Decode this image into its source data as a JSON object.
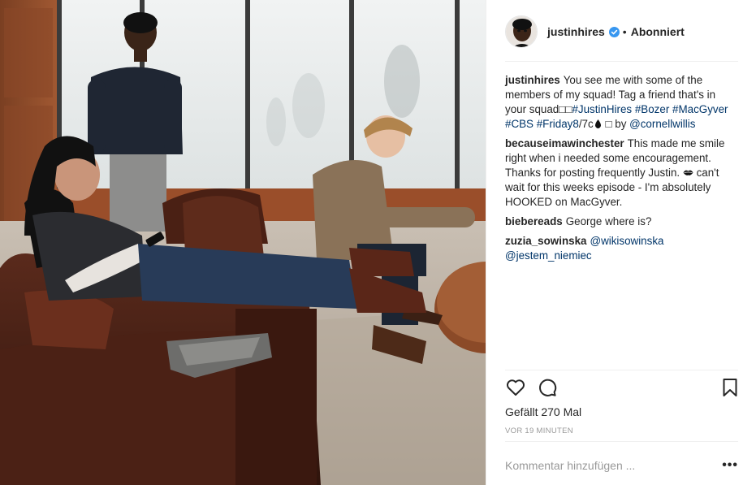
{
  "post": {
    "image_description": "",
    "header": {
      "username": "justinhires",
      "verified": true,
      "separator": "•",
      "follow_status": "Abonniert"
    },
    "caption": {
      "username": "justinhires",
      "text": "You see me with some of the members of my squad! Tag a friend that's in your squad□□",
      "hashtags": [
        "#JustinHires",
        "#Bozer",
        "#MacGyver",
        "#CBS",
        "#Friday8"
      ],
      "tail_text": "/7c",
      "tail_emoji": "□",
      "by_text": " by ",
      "mention": "@cornellwillis"
    },
    "comments": [
      {
        "username": "becauseimawinchester",
        "text_a": "This made me smile right when i needed some encouragement. Thanks for posting frequently Justin.",
        "text_b": "can't wait for this weeks episode - I'm absolutely HOOKED on MacGyver."
      },
      {
        "username": "biebereads",
        "text": "George where is?"
      },
      {
        "username": "zuzia_sowinska",
        "mentions": [
          "@wikisowinska",
          "@jestem_niemiec"
        ]
      }
    ],
    "actions": {
      "like_icon": "heart-outline-icon",
      "comment_icon": "speech-bubble-icon",
      "save_icon": "bookmark-icon"
    },
    "likes_text": "Gefällt 270 Mal",
    "timestamp": "VOR 19 MINUTEN",
    "add_comment_placeholder": "Kommentar hinzufügen ...",
    "more_options": "•••"
  }
}
